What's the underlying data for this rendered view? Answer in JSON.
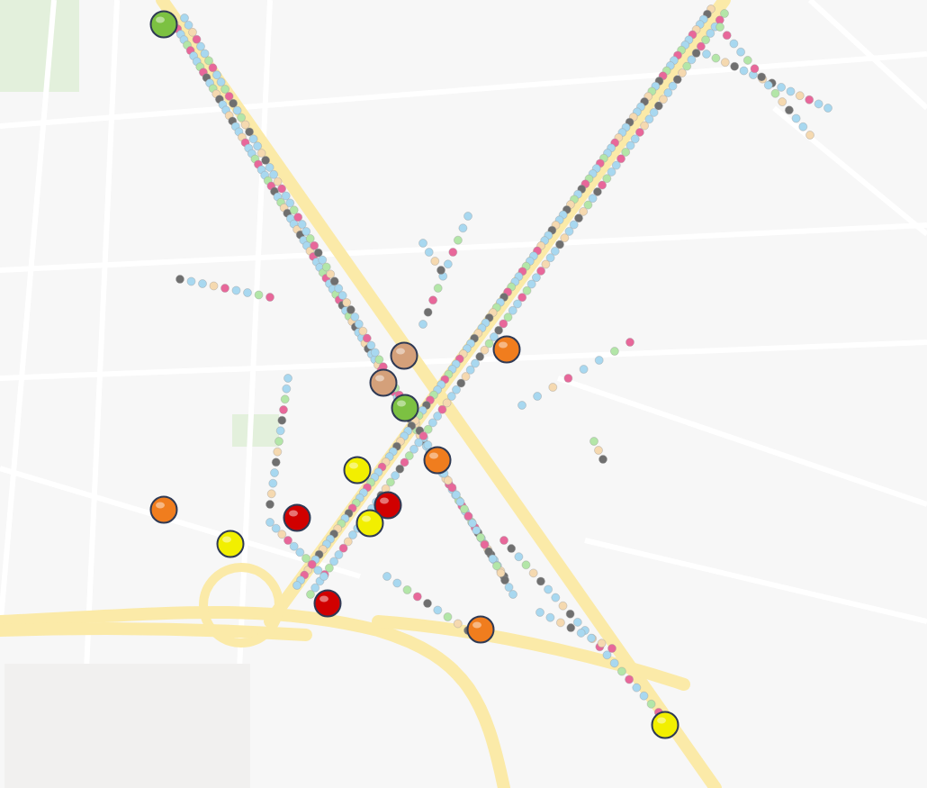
{
  "map": {
    "markers": [
      {
        "color": "#7cc142"
      },
      {
        "color": "#d4a07a"
      },
      {
        "color": "#d4a07a"
      },
      {
        "color": "#7cc142"
      },
      {
        "color": "#f07d1e"
      },
      {
        "color": "#f07d1e"
      },
      {
        "color": "#f2ef00"
      },
      {
        "color": "#f07d1e"
      },
      {
        "color": "#d10000"
      },
      {
        "color": "#d10000"
      },
      {
        "color": "#f2ef00"
      },
      {
        "color": "#f2ef00"
      },
      {
        "color": "#d10000"
      },
      {
        "color": "#f07d1e"
      },
      {
        "color": "#f2ef00"
      }
    ]
  }
}
